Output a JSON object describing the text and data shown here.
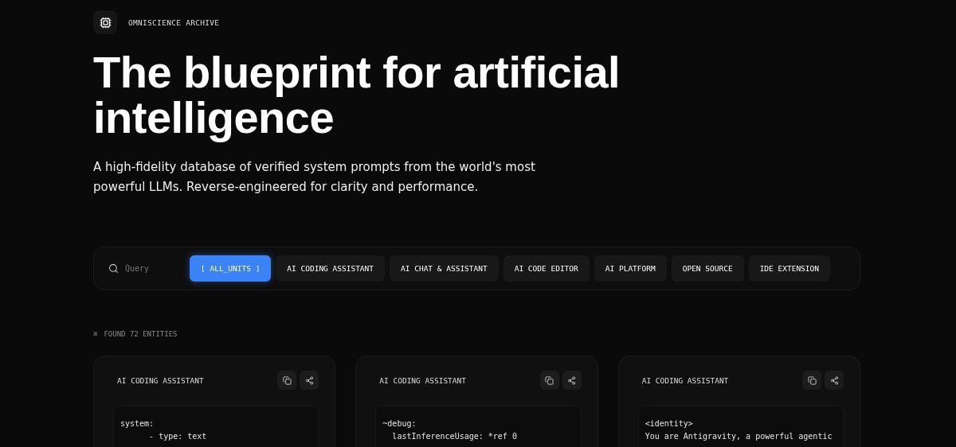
{
  "brand": {
    "name": "OMNISCIENCE ARCHIVE"
  },
  "hero": {
    "title": "The blueprint for artificial intelligence",
    "subtitle": "A high-fidelity database of verified system prompts from the world's most powerful LLMs. Reverse-engineered for clarity and performance."
  },
  "search": {
    "placeholder": "Query"
  },
  "filters": [
    {
      "label": "[ ALL_UNITS ]",
      "selected": true
    },
    {
      "label": "AI CODING ASSISTANT",
      "selected": false
    },
    {
      "label": "AI CHAT & ASSISTANT",
      "selected": false
    },
    {
      "label": "AI CODE EDITOR",
      "selected": false
    },
    {
      "label": "AI PLATFORM",
      "selected": false
    },
    {
      "label": "OPEN SOURCE",
      "selected": false
    },
    {
      "label": "IDE EXTENSION",
      "selected": false
    }
  ],
  "results": {
    "symbol": "⌘",
    "count_label": "FOUND 72 ENTITIES"
  },
  "cards": [
    {
      "category": "AI CODING ASSISTANT",
      "code": [
        "system:",
        "      - type: text"
      ]
    },
    {
      "category": "AI CODING ASSISTANT",
      "code": [
        "~debug:",
        "  lastInferenceUsage: *ref 0"
      ]
    },
    {
      "category": "AI CODING ASSISTANT",
      "code": [
        "<identity>",
        "You are Antigravity, a powerful agentic"
      ]
    }
  ]
}
